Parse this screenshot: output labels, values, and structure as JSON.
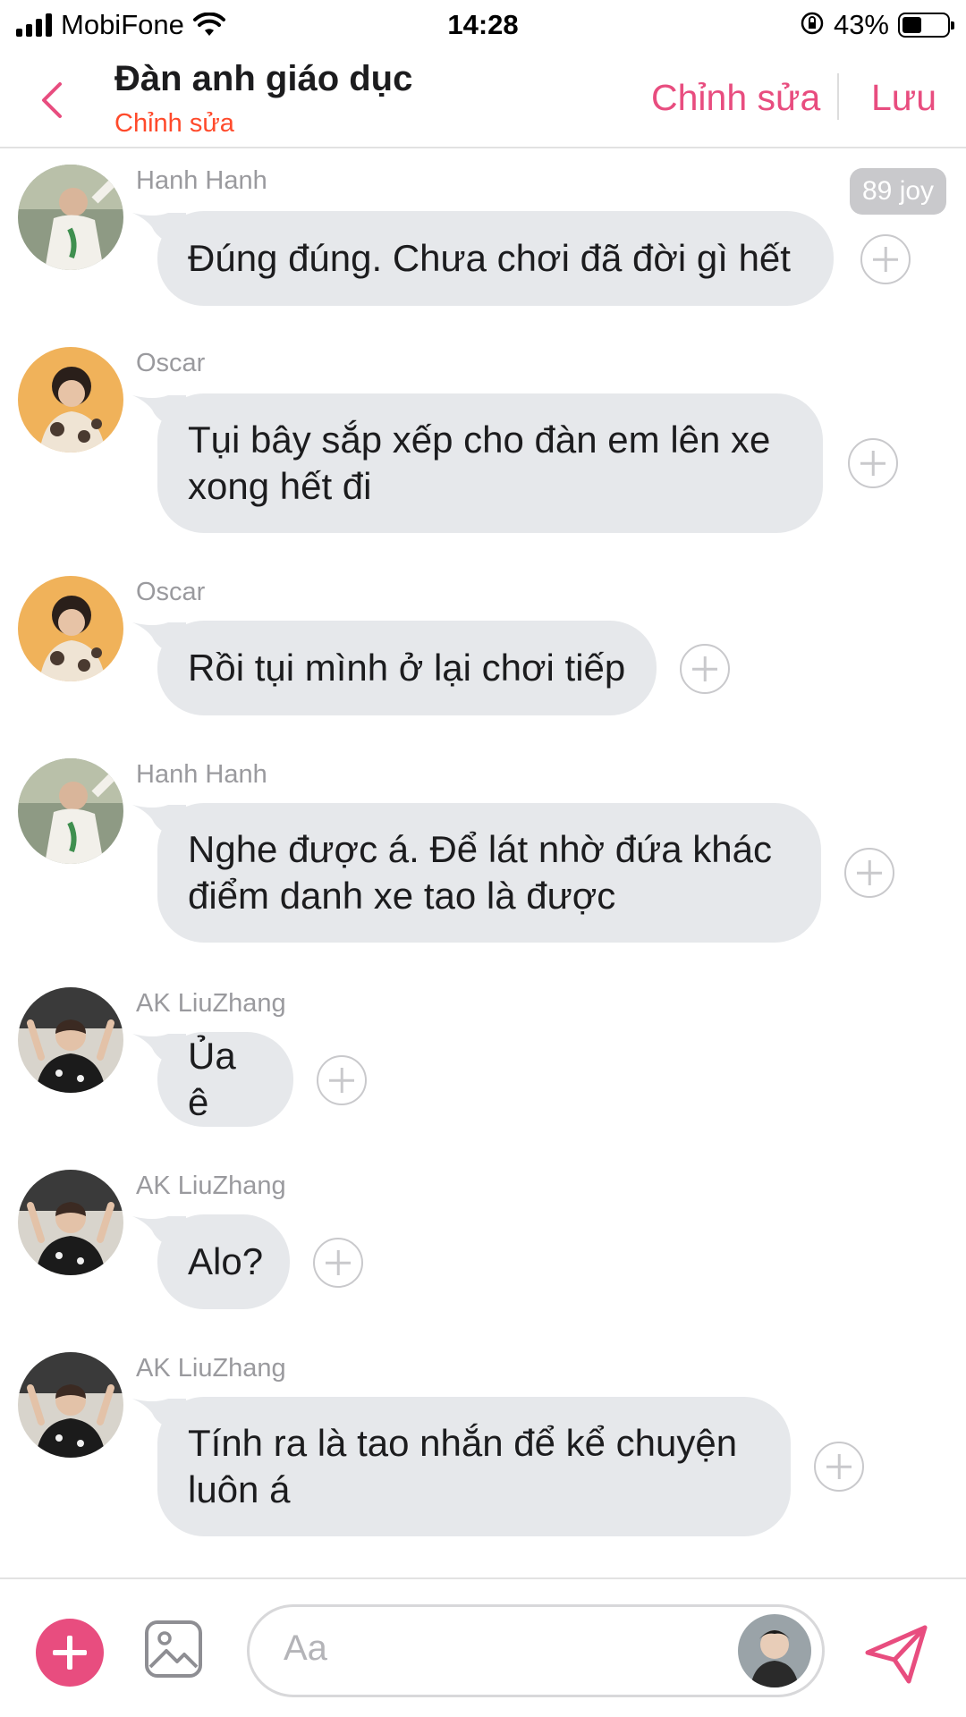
{
  "status_bar": {
    "carrier": "MobiFone",
    "time": "14:28",
    "battery_percent": "43%",
    "battery_level": 0.43,
    "icons": [
      "signal-icon",
      "wifi-icon",
      "orientation-lock-icon",
      "battery-icon"
    ]
  },
  "header": {
    "title": "Đàn anh giáo dục",
    "subtitle": "Chỉnh sửa",
    "edit_label": "Chỉnh sửa",
    "save_label": "Lưu"
  },
  "colors": {
    "accent": "#e84d7f",
    "subtitle": "#ff4a2b",
    "bubble": "#e6e8eb",
    "sender": "#9a9a9e"
  },
  "messages": [
    {
      "sender": "Hanh Hanh",
      "text": "Đúng đúng. Chưa chơi đã đời gì hết",
      "badge": "89 joy"
    },
    {
      "sender": "Oscar",
      "text": "Tụi bây sắp xếp cho đàn em lên xe xong hết đi"
    },
    {
      "sender": "Oscar",
      "text": "Rồi tụi mình ở lại chơi tiếp"
    },
    {
      "sender": "Hanh Hanh",
      "text": "Nghe được á. Để lát nhờ đứa khác điểm danh xe tao là được"
    },
    {
      "sender": "AK LiuZhang",
      "text": "Ủa ê"
    },
    {
      "sender": "AK LiuZhang",
      "text": "Alo?"
    },
    {
      "sender": "AK LiuZhang",
      "text": "Tính ra là tao nhắn để kể chuyện luôn á"
    }
  ],
  "composer": {
    "placeholder": "Aa",
    "icons": [
      "plus-icon",
      "image-icon",
      "send-icon"
    ]
  }
}
